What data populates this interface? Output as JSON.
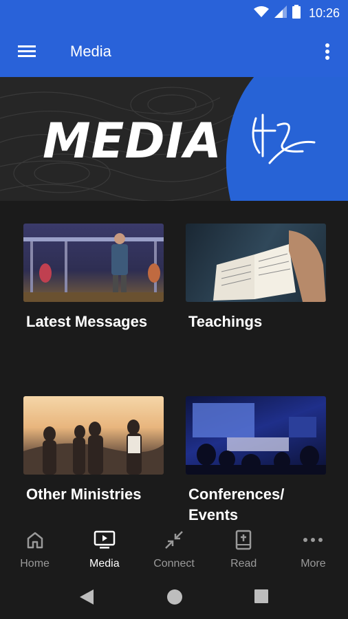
{
  "status_bar": {
    "time": "10:26"
  },
  "app_bar": {
    "title": "Media"
  },
  "banner": {
    "text": "MEDIA"
  },
  "cards": [
    {
      "title": "Latest Messages"
    },
    {
      "title": "Teachings"
    },
    {
      "title": "Other Ministries"
    },
    {
      "title": "Conferences/ Events"
    }
  ],
  "bottom_nav": {
    "items": [
      {
        "label": "Home",
        "icon": "home-icon"
      },
      {
        "label": "Media",
        "icon": "tv-play-icon",
        "active": true
      },
      {
        "label": "Connect",
        "icon": "connect-arrows-icon"
      },
      {
        "label": "Read",
        "icon": "bible-icon"
      },
      {
        "label": "More",
        "icon": "more-dots-icon"
      }
    ]
  },
  "colors": {
    "primary": "#2962d9",
    "background": "#1b1b1b",
    "inactive": "#9a9a9a"
  }
}
